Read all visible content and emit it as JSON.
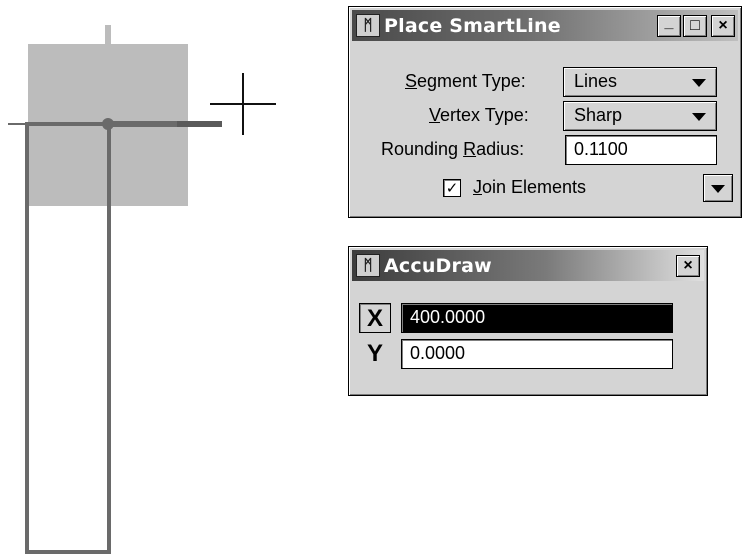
{
  "smartline": {
    "title": "Place SmartLine",
    "minimize_glyph": "_",
    "maximize_glyph": "□",
    "close_glyph": "×",
    "segment_type": {
      "label_u": "S",
      "label_rest": "egment Type:",
      "value": "Lines"
    },
    "vertex_type": {
      "label_u": "V",
      "label_rest": "ertex Type:",
      "value": "Sharp"
    },
    "rounding_radius": {
      "label_pre": "Rounding ",
      "label_u": "R",
      "label_rest": "adius:",
      "value": "0.1100"
    },
    "join_elements": {
      "label_u": "J",
      "label_rest": "oin Elements",
      "checked": "✓"
    }
  },
  "accudraw": {
    "title": "AccuDraw",
    "close_glyph": "×",
    "x": {
      "axis": "X",
      "value": "400.0000"
    },
    "y": {
      "axis": "Y",
      "value": "0.0000"
    }
  },
  "icons": {
    "app_icon": "microstation-logo",
    "dropdown": "chevron-down-icon",
    "cursor": "crosshair-icon"
  },
  "colors": {
    "dialog_bg": "#d4d4d4",
    "selection": "#000000",
    "shape": "#6a6a6a",
    "compass": "#bcbcbc"
  }
}
